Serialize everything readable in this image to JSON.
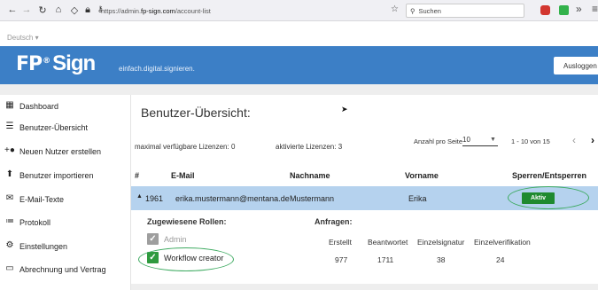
{
  "browser": {
    "url_prefix": "https://admin.",
    "url_host": "fp-sign.com",
    "url_path": "/account-list",
    "search_placeholder": "Suchen"
  },
  "language": "Deutsch",
  "header": {
    "logo_fp": "FP",
    "logo_sign": "Sign",
    "tagline": "einfach.digital.signieren.",
    "logout_label": "Ausloggen",
    "brand_color": "#3c7fc6"
  },
  "sidebar": {
    "items": [
      {
        "label": "Dashboard",
        "icon": "dashboard-icon"
      },
      {
        "label": "Benutzer-Übersicht",
        "icon": "list-icon"
      },
      {
        "label": "Neuen Nutzer erstellen",
        "icon": "add-user-icon"
      },
      {
        "label": "Benutzer importieren",
        "icon": "import-icon"
      },
      {
        "label": "E-Mail-Texte",
        "icon": "mail-icon"
      },
      {
        "label": "Protokoll",
        "icon": "log-icon"
      },
      {
        "label": "Einstellungen",
        "icon": "gear-icon"
      },
      {
        "label": "Abrechnung und Vertrag",
        "icon": "card-icon"
      }
    ]
  },
  "main": {
    "title": "Benutzer-Übersicht:",
    "licenses_available": "maximal verfügbare Lizenzen: 0",
    "licenses_active": "aktivierte Lizenzen: 3",
    "per_page_label": "Anzahl pro Seite",
    "per_page_value": "10",
    "range": "1 - 10 von 15",
    "columns": [
      "#",
      "E-Mail",
      "Nachname",
      "Vorname",
      "Sperren/Entsperren"
    ],
    "row": {
      "id": "1961",
      "email": "erika.mustermann@mentana.de",
      "lastname": "Mustermann",
      "firstname": "Erika",
      "status": "Aktiv"
    },
    "details": {
      "roles_label": "Zugewiesene Rollen:",
      "roles": [
        {
          "name": "Admin",
          "checked": true,
          "enabled": false
        },
        {
          "name": "Workflow creator",
          "checked": true,
          "enabled": true
        }
      ],
      "requests_label": "Anfragen:",
      "request_headers": [
        "Erstellt",
        "Beantwortet",
        "Einzelsignatur",
        "Einzelverifikation"
      ],
      "request_values": [
        "977",
        "1711",
        "38",
        "24"
      ]
    }
  }
}
